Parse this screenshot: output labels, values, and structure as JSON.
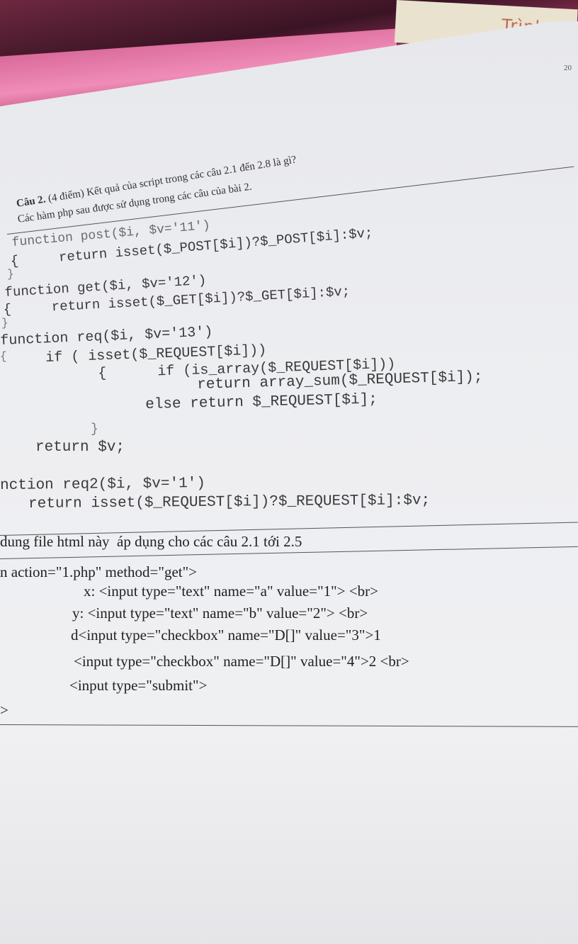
{
  "background": {
    "card_handwriting": "Trình",
    "page_number": "20"
  },
  "question": {
    "title_bold": "Câu 2.",
    "title_rest": " (4 điểm) Kết quả của script trong các câu 2.1 đến 2.8 là gì?",
    "subtitle": "Các hàm php sau được sử dụng trong các câu của bài 2."
  },
  "code_lines": [
    "function post($i, $v='11')",
    "{     return isset($_POST[$i])?$_POST[$i]:$v;",
    "}",
    "function get($i, $v='12')",
    "{     return isset($_GET[$i])?$_GET[$i]:$v;",
    "}",
    "function req($i, $v='13')",
    "{",
    "if ( isset($_REQUEST[$i]))",
    "{      if (is_array($_REQUEST[$i]))",
    "return array_sum($_REQUEST[$i]);",
    "else return $_REQUEST[$i];",
    "}",
    "return $v;",
    "nction req2($i, $v='1')",
    "return isset($_REQUEST[$i])?$_REQUEST[$i]:$v;"
  ],
  "html_section": {
    "heading": "dung file html này  áp dụng cho các câu 2.1 tới 2.5",
    "lines": [
      "n action=\"1.php\" method=\"get\">",
      "x: <input type=\"text\" name=\"a\" value=\"1\"> <br>",
      "y: <input type=\"text\" name=\"b\" value=\"2\"> <br>",
      "d<input type=\"checkbox\" name=\"D[]\" value=\"3\">1",
      "<input type=\"checkbox\" name=\"D[]\" value=\"4\">2 <br>",
      "<input type=\"submit\">",
      ">"
    ]
  }
}
